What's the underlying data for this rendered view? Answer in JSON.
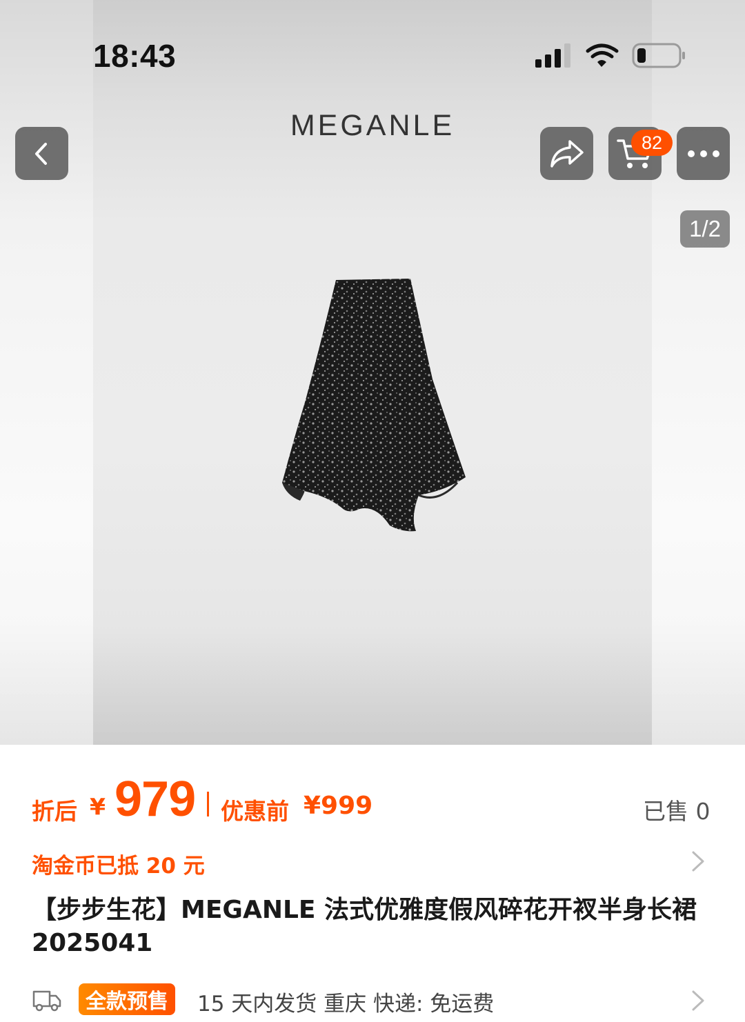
{
  "status_bar": {
    "time": "18:43",
    "icons": [
      "cellular-signal-icon",
      "wifi-icon",
      "battery-icon"
    ]
  },
  "header": {
    "brand": "MEGANLE",
    "cart_count": "82",
    "image_index": "1/2"
  },
  "price": {
    "after_label": "折后",
    "currency": "¥",
    "after_value": "979",
    "before_label": "优惠前",
    "before_value": "¥999",
    "sold": "已售 0"
  },
  "coin": {
    "text": "淘金币已抵 20 元"
  },
  "product": {
    "title": "【步步生花】MEGANLE  法式优雅度假风碎花开衩半身长裙 2025041"
  },
  "shipping": {
    "badge": "全款预售",
    "text": "15 天内发货  重庆  快递: 免运费"
  },
  "colors": {
    "accent": "#ff5000",
    "button_bg": "#646464"
  }
}
